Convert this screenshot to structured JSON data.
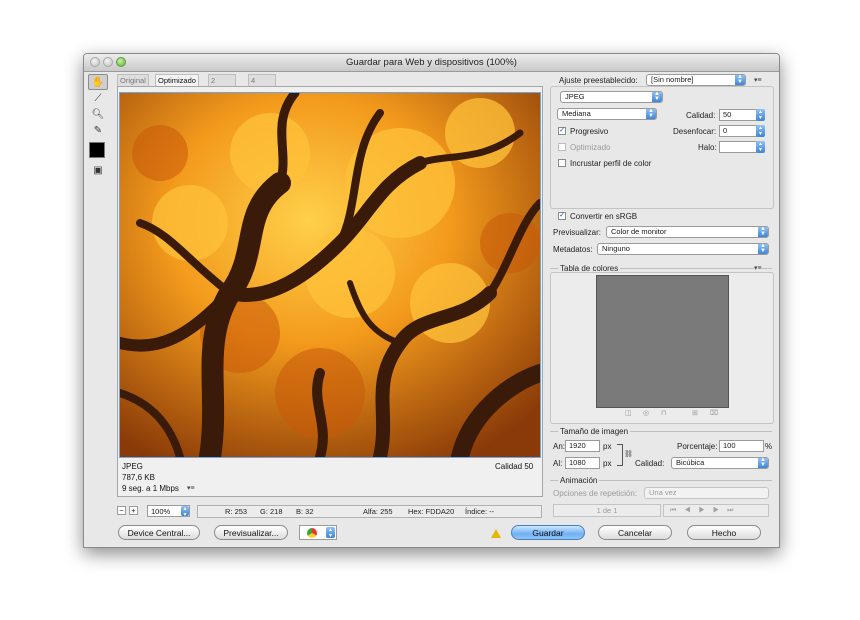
{
  "window": {
    "title": "Guardar para Web y dispositivos (100%)"
  },
  "tabs": [
    "Original",
    "Optimizado",
    "2 copias",
    "4 copias"
  ],
  "preview": {
    "format": "JPEG",
    "size": "787,6 KB",
    "time": "9 seg. a 1 Mbps",
    "quality_label": "Calidad 50"
  },
  "zoom": "100%",
  "status": {
    "r": "R: 253",
    "g": "G: 218",
    "b": "B: 32",
    "alpha": "Alfa: 255",
    "hex": "Hex: FDDA20",
    "index": "Índice: --"
  },
  "buttons": {
    "device_central": "Device Central...",
    "preview": "Previsualizar...",
    "save": "Guardar",
    "cancel": "Cancelar",
    "done": "Hecho"
  },
  "settings": {
    "preset_label": "Ajuste preestablecido:",
    "preset_value": "[Sin nombre]",
    "format_value": "JPEG",
    "quality_level": "Mediana",
    "quality_label": "Calidad:",
    "quality_value": "50",
    "progressive_label": "Progresivo",
    "progressive_checked": true,
    "blur_label": "Desenfocar:",
    "blur_value": "0",
    "optimized_label": "Optimizado",
    "halo_label": "Halo:",
    "embed_profile_label": "Incrustar perfil de color",
    "convert_srgb_label": "Convertir en sRGB",
    "convert_srgb_checked": true,
    "preview_label": "Previsualizar:",
    "preview_value": "Color de monitor",
    "metadata_label": "Metadatos:",
    "metadata_value": "Ninguno"
  },
  "color_table": {
    "title": "Tabla de colores",
    "swatch_color": "#7a7a7a"
  },
  "image_size": {
    "title": "Tamaño de imagen",
    "width_label": "An:",
    "width_value": "1920",
    "height_label": "Al:",
    "height_value": "1080",
    "unit": "px",
    "percent_label": "Porcentaje:",
    "percent_value": "100",
    "percent_unit": "%",
    "quality_label": "Calidad:",
    "quality_value": "Bicúbica"
  },
  "animation": {
    "title": "Animación",
    "loop_label": "Opciones de repetición:",
    "loop_value": "Una vez",
    "frame_counter": "1 de 1"
  },
  "colors": {
    "accent": "#3f86d6",
    "tree_orange": "#f39a1c",
    "bark": "#3a1a08"
  }
}
